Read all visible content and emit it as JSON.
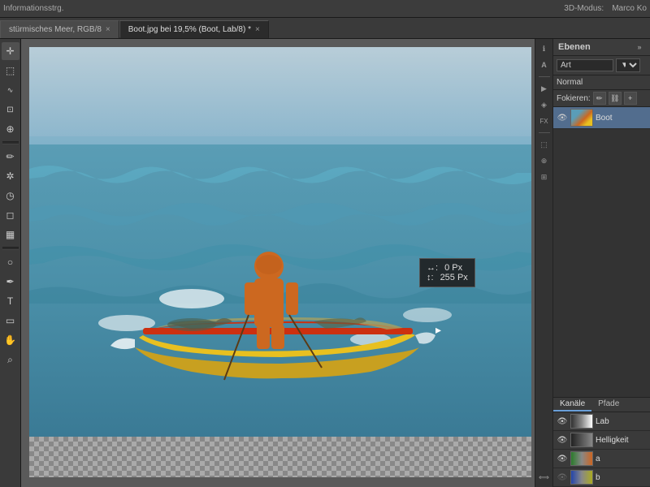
{
  "topbar": {
    "info_text": "Informationsstrg.",
    "user_name": "Marco Ko",
    "three_d_mode": "3D-Modus:"
  },
  "tabs": [
    {
      "label": "stuermisches Meer, RGB/8",
      "active": false,
      "closeable": true
    },
    {
      "label": "Boot.jpg bei 19,5% (Boot, Lab/8) *",
      "active": true,
      "closeable": true
    }
  ],
  "canvas": {
    "tooltip": {
      "x_label": "↔:",
      "x_value": "0 Px",
      "y_label": "↕:",
      "y_value": "255 Px"
    }
  },
  "layers_panel": {
    "title": "Ebenen",
    "search_placeholder": "Art",
    "blend_mode": "Normal",
    "focussieren_label": "Fokieren:",
    "layer": {
      "name": "Boot",
      "visible": true
    }
  },
  "channels_panel": {
    "tabs": [
      {
        "label": "Kanäle",
        "active": true
      },
      {
        "label": "Pfade",
        "active": false
      }
    ],
    "channels": [
      {
        "name": "Lab",
        "class": "ch-lab"
      },
      {
        "name": "Helligkeit",
        "class": "ch-hell"
      },
      {
        "name": "a",
        "class": "ch-a"
      },
      {
        "name": "b",
        "class": "ch-a"
      }
    ]
  },
  "tools": {
    "items": [
      {
        "name": "move",
        "icon": "✛"
      },
      {
        "name": "select",
        "icon": "⬚"
      },
      {
        "name": "lasso",
        "icon": "𝓛"
      },
      {
        "name": "crop",
        "icon": "⊡"
      },
      {
        "name": "heal",
        "icon": "⊕"
      },
      {
        "name": "brush",
        "icon": "✏"
      },
      {
        "name": "clone",
        "icon": "✲"
      },
      {
        "name": "history",
        "icon": "◷"
      },
      {
        "name": "eraser",
        "icon": "◻"
      },
      {
        "name": "gradient",
        "icon": "▦"
      },
      {
        "name": "dodge",
        "icon": "○"
      },
      {
        "name": "pen",
        "icon": "✒"
      },
      {
        "name": "type",
        "icon": "T"
      },
      {
        "name": "shape",
        "icon": "▭"
      },
      {
        "name": "hand",
        "icon": "✋"
      },
      {
        "name": "zoom",
        "icon": "⌕"
      }
    ]
  },
  "right_icons": [
    "ℹ",
    "A",
    "|",
    "►",
    "◈",
    "FX",
    "⬚",
    "⊕",
    "⊞"
  ],
  "colors": {
    "accent_blue": "#526d8e",
    "panel_bg": "#3a3a3a",
    "tab_active_bg": "#2b2b2b"
  }
}
